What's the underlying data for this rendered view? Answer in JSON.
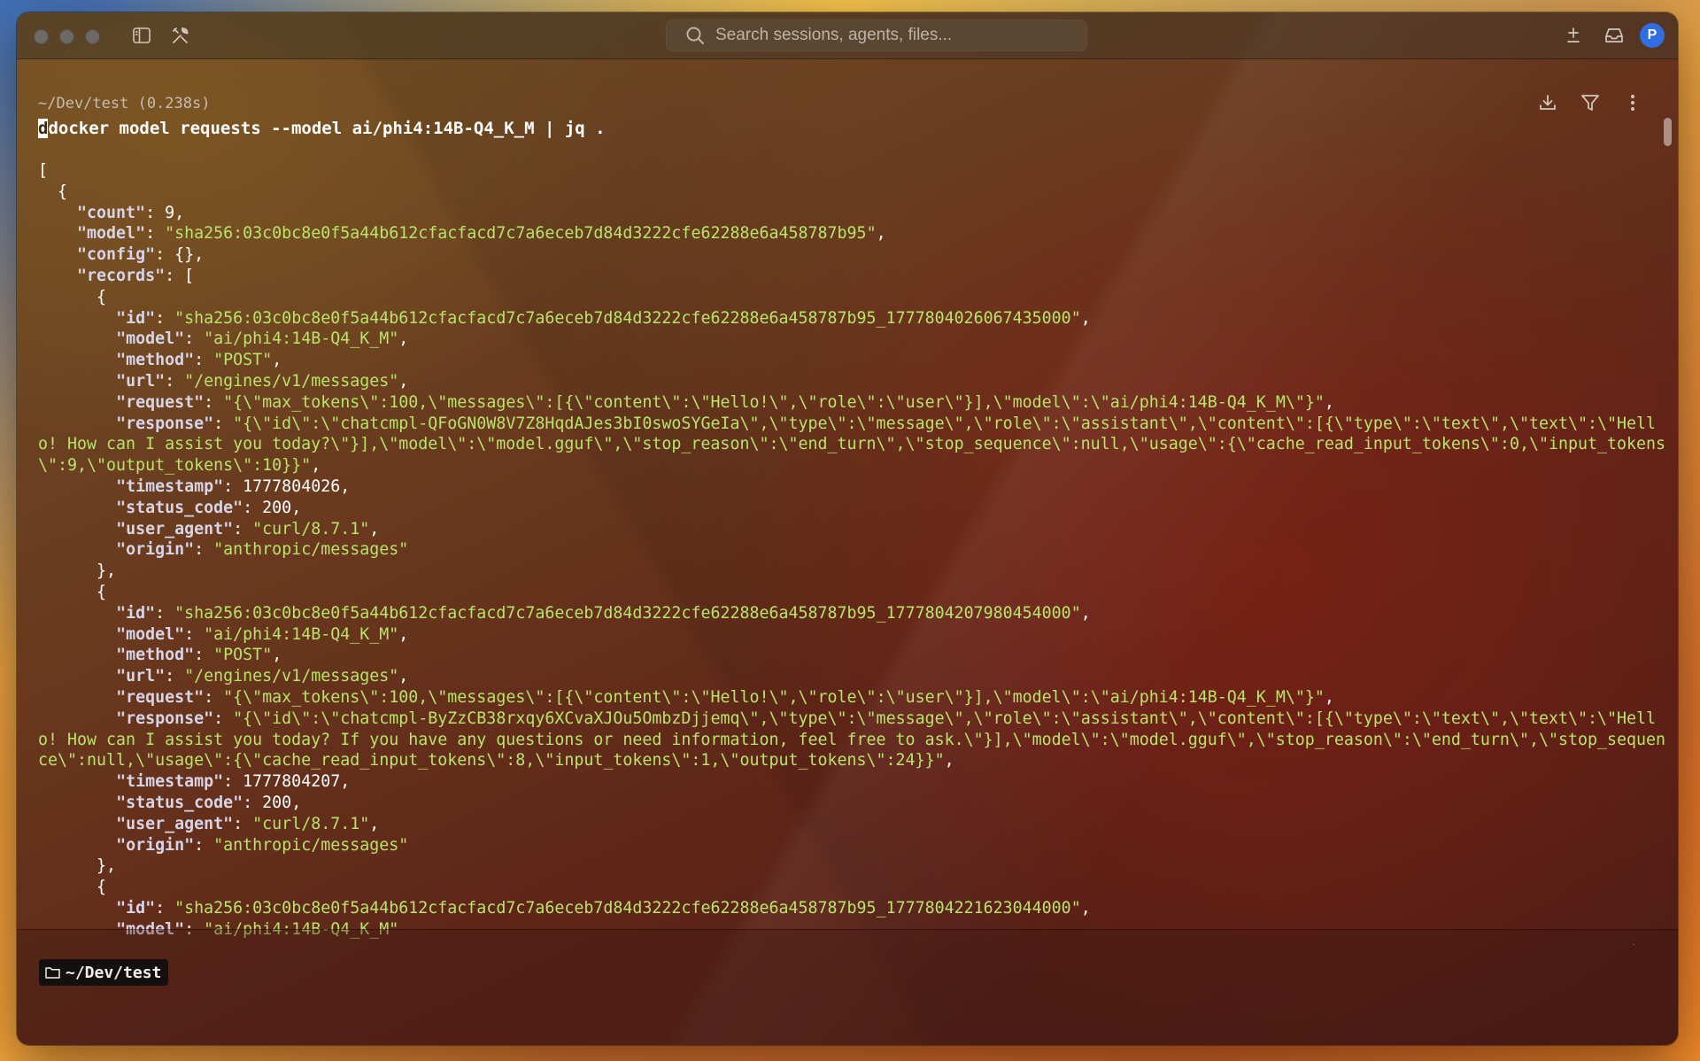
{
  "titlebar": {
    "search_placeholder": "Search sessions, agents, files...",
    "avatar_initial": "P"
  },
  "block": {
    "cwd_timing": "~/Dev/test (0.238s)",
    "command_first_char": "d",
    "command_rest": "docker model requests --model ai/phi4:14B-Q4_K_M | jq ."
  },
  "output": {
    "count": 9,
    "model": "sha256:03c0bc8e0f5a44b612cfacfacd7c7a6eceb7d84d3222cfe62288e6a458787b95",
    "config": "{}",
    "records": [
      {
        "id": "sha256:03c0bc8e0f5a44b612cfacfacd7c7a6eceb7d84d3222cfe62288e6a458787b95_1777804026067435000",
        "model": "ai/phi4:14B-Q4_K_M",
        "method": "POST",
        "url": "/engines/v1/messages",
        "request": "{\\\"max_tokens\\\":100,\\\"messages\\\":[{\\\"content\\\":\\\"Hello!\\\",\\\"role\\\":\\\"user\\\"}],\\\"model\\\":\\\"ai/phi4:14B-Q4_K_M\\\"}",
        "response": "{\\\"id\\\":\\\"chatcmpl-QFoGN0W8V7Z8HqdAJes3bI0swoSYGeIa\\\",\\\"type\\\":\\\"message\\\",\\\"role\\\":\\\"assistant\\\",\\\"content\\\":[{\\\"type\\\":\\\"text\\\",\\\"text\\\":\\\"Hello! How can I assist you today?\\\"}],\\\"model\\\":\\\"model.gguf\\\",\\\"stop_reason\\\":\\\"end_turn\\\",\\\"stop_sequence\\\":null,\\\"usage\\\":{\\\"cache_read_input_tokens\\\":0,\\\"input_tokens\\\":9,\\\"output_tokens\\\":10}}",
        "timestamp": 1777804026,
        "status_code": 200,
        "user_agent": "curl/8.7.1",
        "origin": "anthropic/messages"
      },
      {
        "id": "sha256:03c0bc8e0f5a44b612cfacfacd7c7a6eceb7d84d3222cfe62288e6a458787b95_1777804207980454000",
        "model": "ai/phi4:14B-Q4_K_M",
        "method": "POST",
        "url": "/engines/v1/messages",
        "request": "{\\\"max_tokens\\\":100,\\\"messages\\\":[{\\\"content\\\":\\\"Hello!\\\",\\\"role\\\":\\\"user\\\"}],\\\"model\\\":\\\"ai/phi4:14B-Q4_K_M\\\"}",
        "response": "{\\\"id\\\":\\\"chatcmpl-ByZzCB38rxqy6XCvaXJOu5OmbzDjjemq\\\",\\\"type\\\":\\\"message\\\",\\\"role\\\":\\\"assistant\\\",\\\"content\\\":[{\\\"type\\\":\\\"text\\\",\\\"text\\\":\\\"Hello! How can I assist you today? If you have any questions or need information, feel free to ask.\\\"}],\\\"model\\\":\\\"model.gguf\\\",\\\"stop_reason\\\":\\\"end_turn\\\",\\\"stop_sequence\\\":null,\\\"usage\\\":{\\\"cache_read_input_tokens\\\":8,\\\"input_tokens\\\":1,\\\"output_tokens\\\":24}}",
        "timestamp": 1777804207,
        "status_code": 200,
        "user_agent": "curl/8.7.1",
        "origin": "anthropic/messages"
      },
      {
        "id": "sha256:03c0bc8e0f5a44b612cfacfacd7c7a6eceb7d84d3222cfe62288e6a458787b95_1777804221623044000",
        "model": "ai/phi4:14B-Q4_K_M"
      }
    ]
  },
  "bottombar": {
    "cwd_chip": "~/Dev/test"
  },
  "icons": {
    "sidebar_toggle": "sidebar-icon",
    "tools": "tools-icon",
    "search": "search-icon",
    "new_tab": "plus-minus-icon",
    "inbox": "inbox-icon",
    "download": "download-icon",
    "filter": "filter-icon",
    "more": "more-vertical-icon",
    "scroll_bottom": "scroll-to-bottom-icon",
    "folder": "folder-icon"
  }
}
